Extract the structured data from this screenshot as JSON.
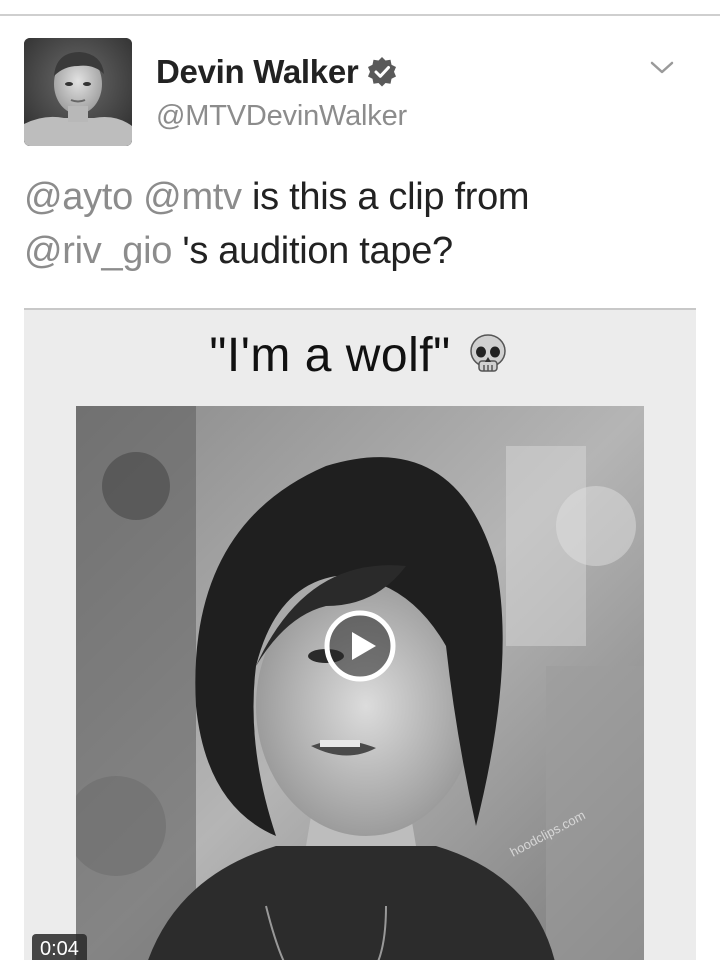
{
  "tweet": {
    "author": {
      "display_name": "Devin Walker",
      "handle": "@MTVDevinWalker",
      "verified": true
    },
    "text_segments": [
      {
        "text": "@ayto",
        "type": "mention"
      },
      {
        "text": " ",
        "type": "text"
      },
      {
        "text": "@mtv",
        "type": "mention"
      },
      {
        "text": " is this a clip from ",
        "type": "text"
      },
      {
        "text": "@riv_gio",
        "type": "mention"
      },
      {
        "text": " 's audition tape?",
        "type": "text"
      }
    ],
    "media": {
      "caption": "\"I'm a wolf\"",
      "caption_emoji": "skull-icon",
      "watermark": "hoodclips.com",
      "duration": "0:04",
      "type": "video"
    }
  },
  "icons": {
    "verified": "verified-badge-icon",
    "menu": "chevron-down-icon",
    "play": "play-icon"
  },
  "colors": {
    "text": "#222222",
    "secondary": "#8c8c8c",
    "background": "#ffffff"
  }
}
